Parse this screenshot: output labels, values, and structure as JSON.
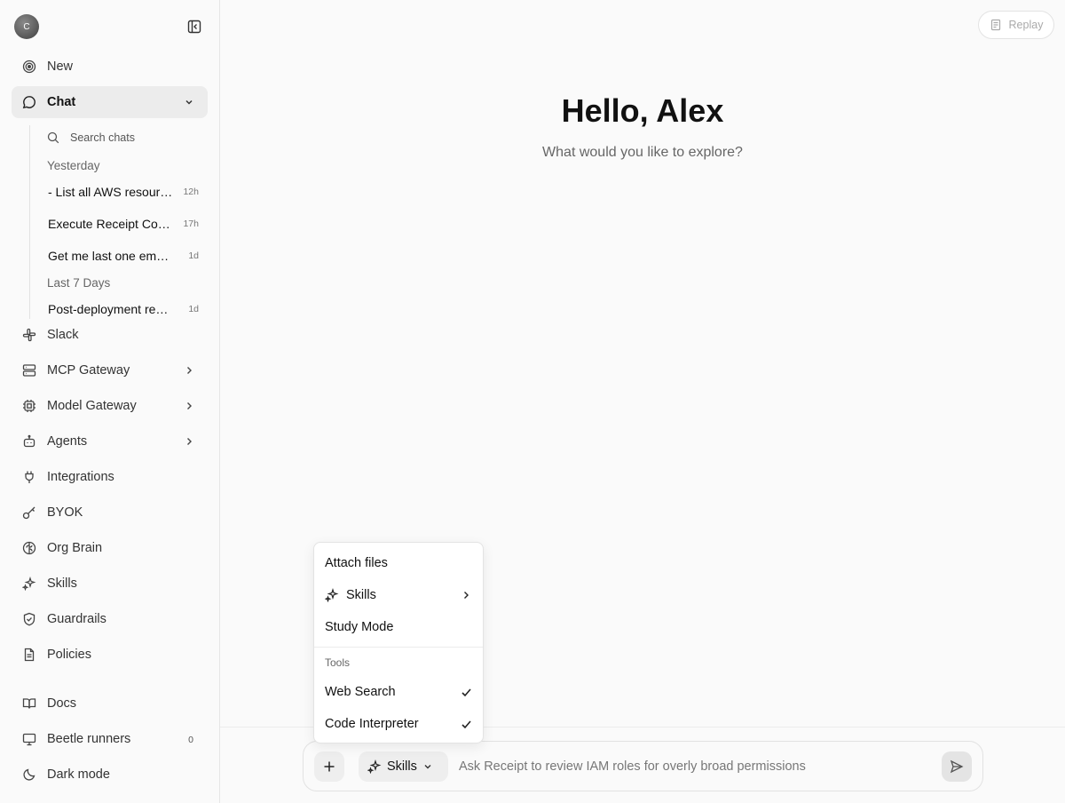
{
  "sidebar": {
    "avatar_initial": "C",
    "nav": {
      "new": "New",
      "chat": "Chat",
      "slack": "Slack",
      "mcp_gateway": "MCP Gateway",
      "model_gateway": "Model Gateway",
      "agents": "Agents",
      "integrations": "Integrations",
      "byok": "BYOK",
      "org_brain": "Org Brain",
      "skills": "Skills",
      "guardrails": "Guardrails",
      "policies": "Policies",
      "docs": "Docs",
      "beetle_runners": "Beetle runners",
      "beetle_runners_count": "0",
      "dark_mode": "Dark mode"
    },
    "chat_section": {
      "search_label": "Search chats",
      "groups": [
        {
          "label": "Yesterday",
          "items": [
            {
              "title": "- List all AWS resources",
              "age": "12h"
            },
            {
              "title": "Execute Receipt Controls",
              "age": "17h"
            },
            {
              "title": "Get me last one email from inbox",
              "age": "1d"
            }
          ]
        },
        {
          "label": "Last 7 Days",
          "items": [
            {
              "title": "Post-deployment readiness",
              "age": "1d"
            }
          ]
        }
      ]
    }
  },
  "header": {
    "replay_label": "Replay"
  },
  "main": {
    "greeting": "Hello, Alex",
    "subtitle": "What would you like to explore?"
  },
  "composer": {
    "skills_label": "Skills",
    "placeholder": "Ask Receipt to review IAM roles for overly broad permissions"
  },
  "popover": {
    "attach_files": "Attach files",
    "skills": "Skills",
    "study_mode": "Study Mode",
    "tools_heading": "Tools",
    "tools": [
      {
        "label": "Web Search",
        "checked": true
      },
      {
        "label": "Code Interpreter",
        "checked": true
      }
    ]
  }
}
